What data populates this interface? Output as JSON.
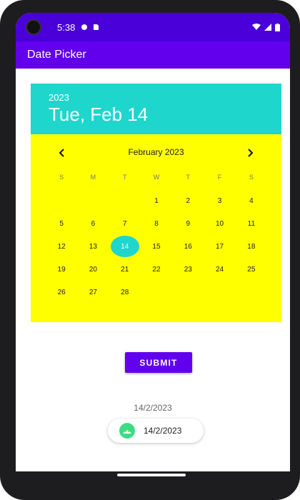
{
  "status_bar": {
    "time": "5:38",
    "icons_left": [
      "notification-dot-icon",
      "sim-card-icon"
    ],
    "icons_right": [
      "wifi-icon",
      "signal-icon",
      "battery-icon"
    ]
  },
  "app_bar": {
    "title": "Date Picker"
  },
  "picker": {
    "year": "2023",
    "selected_date_label": "Tue, Feb 14",
    "month_label": "February 2023",
    "weekdays": [
      "S",
      "M",
      "T",
      "W",
      "T",
      "F",
      "S"
    ],
    "days": [
      "",
      "",
      "",
      "1",
      "2",
      "3",
      "4",
      "5",
      "6",
      "7",
      "8",
      "9",
      "10",
      "11",
      "12",
      "13",
      "14",
      "15",
      "16",
      "17",
      "18",
      "19",
      "20",
      "21",
      "22",
      "23",
      "24",
      "25",
      "26",
      "27",
      "28"
    ],
    "selected_day": "14",
    "colors": {
      "header": "#1fd6cd",
      "body": "#ffff00",
      "selected": "#1fd6cd"
    }
  },
  "submit_button": {
    "label": "SUBMIT"
  },
  "result": {
    "text": "14/2/2023",
    "toast_text": "14/2/2023",
    "toast_icon": "android-icon"
  },
  "theme": {
    "status_bar": "#4a00d9",
    "app_bar": "#6200ee",
    "button": "#6200ee"
  }
}
